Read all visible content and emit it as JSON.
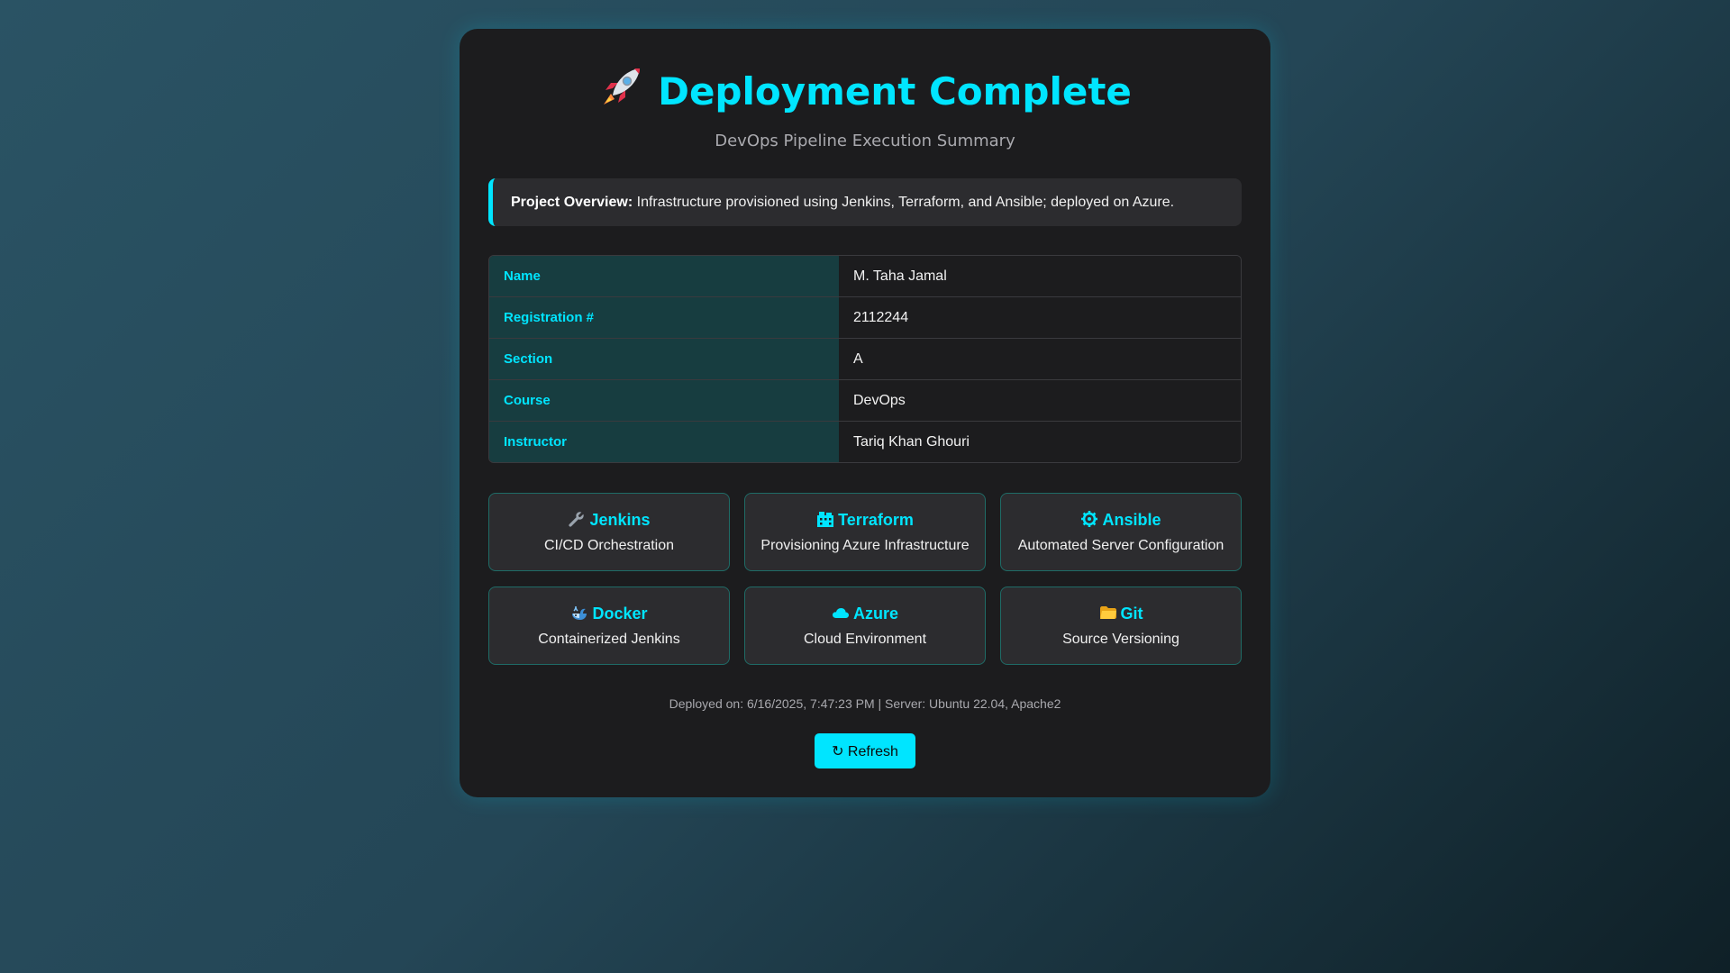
{
  "header": {
    "title": "Deployment Complete",
    "title_icon": "rocket-icon",
    "subtitle": "DevOps Pipeline Execution Summary"
  },
  "overview": {
    "label": "Project Overview:",
    "text": " Infrastructure provisioned using Jenkins, Terraform, and Ansible; deployed on Azure."
  },
  "info_table": [
    {
      "label": "Name",
      "value": "M. Taha Jamal"
    },
    {
      "label": "Registration #",
      "value": "2112244"
    },
    {
      "label": "Section",
      "value": "A"
    },
    {
      "label": "Course",
      "value": "DevOps"
    },
    {
      "label": "Instructor",
      "value": "Tariq Khan Ghouri"
    }
  ],
  "tools": [
    {
      "name": "Jenkins",
      "desc": "CI/CD Orchestration",
      "icon": "wrench-icon"
    },
    {
      "name": "Terraform",
      "desc": "Provisioning Azure Infrastructure",
      "icon": "building-icon"
    },
    {
      "name": "Ansible",
      "desc": "Automated Server Configuration",
      "icon": "gear-icon"
    },
    {
      "name": "Docker",
      "desc": "Containerized Jenkins",
      "icon": "whale-icon"
    },
    {
      "name": "Azure",
      "desc": "Cloud Environment",
      "icon": "cloud-icon"
    },
    {
      "name": "Git",
      "desc": "Source Versioning",
      "icon": "folder-icon"
    }
  ],
  "footer": {
    "text": "Deployed on: 6/16/2025, 7:47:23 PM | Server: Ubuntu 22.04, Apache2"
  },
  "refresh_button": {
    "label": "↻ Refresh"
  },
  "colors": {
    "accent": "#00e5ff",
    "card_bg": "#1c1c1e",
    "label_bg": "#173d40"
  }
}
